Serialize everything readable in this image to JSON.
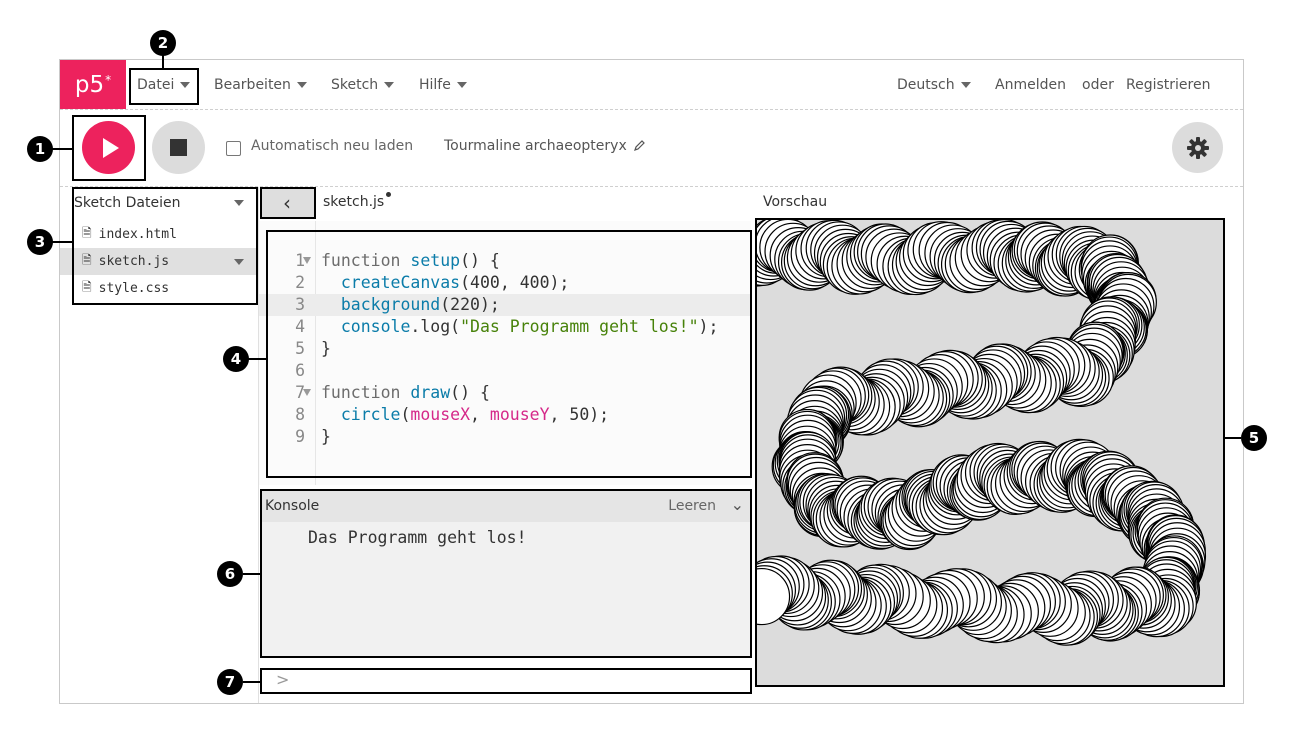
{
  "nav": {
    "logo": "p5",
    "logo_sup": "*",
    "menu": [
      "Datei",
      "Bearbeiten",
      "Sketch",
      "Hilfe"
    ],
    "language": "Deutsch",
    "login": "Anmelden",
    "or": "oder",
    "register": "Registrieren"
  },
  "toolbar": {
    "auto_reload": "Automatisch neu laden",
    "sketch_name": "Tourmaline archaeopteryx",
    "auto_reload_checked": false
  },
  "sidebar": {
    "title": "Sketch Dateien",
    "files": [
      {
        "name": "index.html",
        "selected": false
      },
      {
        "name": "sketch.js",
        "selected": true
      },
      {
        "name": "style.css",
        "selected": false
      }
    ]
  },
  "editor": {
    "tab": "sketch.js",
    "highlighted_line": 3,
    "lines": [
      "1",
      "2",
      "3",
      "4",
      "5",
      "6",
      "7",
      "8",
      "9"
    ]
  },
  "console": {
    "title": "Konsole",
    "clear": "Leeren",
    "message": "Das Programm geht los!",
    "prompt": ">"
  },
  "preview": {
    "label": "Vorschau"
  },
  "callouts": [
    "1",
    "2",
    "3",
    "4",
    "5",
    "6",
    "7"
  ],
  "colors": {
    "accent": "#ed225d",
    "preview_bg": "#dcdcdc"
  }
}
